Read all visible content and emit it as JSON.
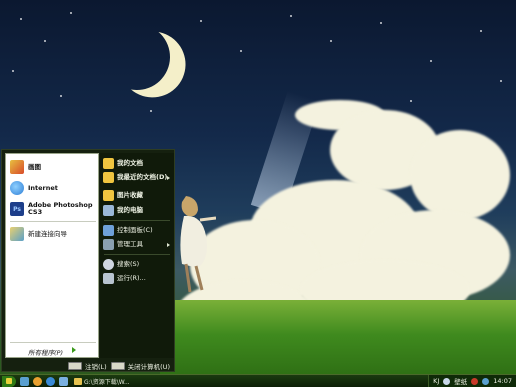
{
  "start_menu": {
    "left_items": [
      {
        "label": "画图",
        "icon": "paint-icon",
        "color": "#d84a2a"
      },
      {
        "label": "Internet",
        "icon": "internet-explorer-icon",
        "color": "#2f7fd6"
      },
      {
        "label": "Adobe Photoshop CS3",
        "icon": "photoshop-icon",
        "color": "#1d3e8a"
      },
      {
        "label": "新建连接向导",
        "icon": "network-wizard-icon",
        "color": "#5aa0c8"
      }
    ],
    "all_programs": "所有程序(P)",
    "right_items": [
      {
        "label": "我的文档",
        "icon": "my-documents-icon",
        "color": "#f0c540",
        "bold": true
      },
      {
        "label": "我最近的文档(D)",
        "icon": "recent-documents-icon",
        "color": "#f0c540",
        "bold": true
      },
      {
        "label": "图片收藏",
        "icon": "my-pictures-icon",
        "color": "#f0c540",
        "bold": true
      },
      {
        "label": "我的电脑",
        "icon": "my-computer-icon",
        "color": "#9ab7d8",
        "bold": true
      },
      {
        "label": "控制面板(C)",
        "icon": "control-panel-icon",
        "color": "#6ea0d8",
        "bold": false
      },
      {
        "label": "管理工具",
        "icon": "admin-tools-icon",
        "color": "#8aa0b0",
        "bold": false
      },
      {
        "label": "搜索(S)",
        "icon": "search-icon",
        "color": "#cfd6e0",
        "bold": false
      },
      {
        "label": "运行(R)...",
        "icon": "run-icon",
        "color": "#b8c4d0",
        "bold": false
      }
    ],
    "logoff": "注销(L)",
    "shutdown": "关闭计算机(U)"
  },
  "taskbar": {
    "task_label": "G:\\资源下载\\W...",
    "tray_ime": "KJ",
    "tray_label": "壁纸",
    "clock": "14:07"
  }
}
